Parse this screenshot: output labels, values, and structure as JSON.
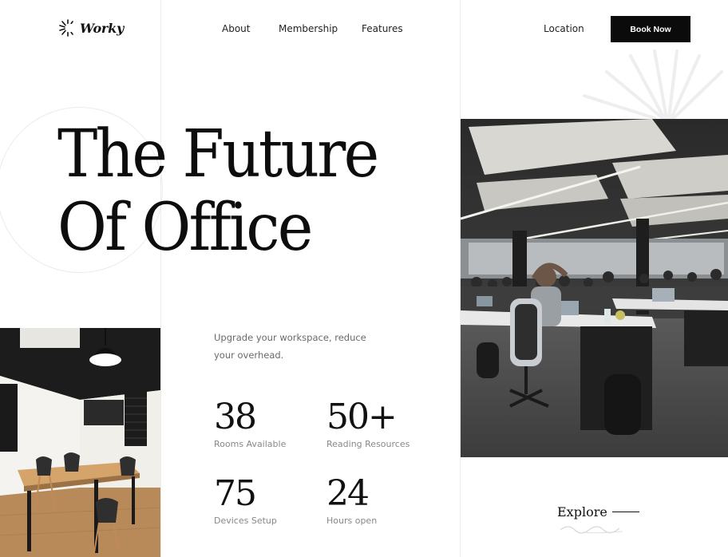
{
  "brand": {
    "name": "Worky",
    "logo_icon": "sunburst-c-icon"
  },
  "nav": {
    "links": [
      "About",
      "Membership",
      "Features",
      "Location"
    ],
    "cta": "Book Now"
  },
  "hero": {
    "title_line1": "The Future",
    "title_line2": "Of Office",
    "subtitle": "Upgrade your workspace, reduce your overhead."
  },
  "stats": [
    {
      "value": "38",
      "label": "Rooms Available"
    },
    {
      "value": "50+",
      "label": "Reading Resources"
    },
    {
      "value": "75",
      "label": "Devices Setup"
    },
    {
      "value": "24",
      "label": "Hours open"
    }
  ],
  "explore": {
    "label": "Explore"
  },
  "colors": {
    "primary": "#0b0b0b",
    "muted": "#888888",
    "background": "#ffffff"
  }
}
